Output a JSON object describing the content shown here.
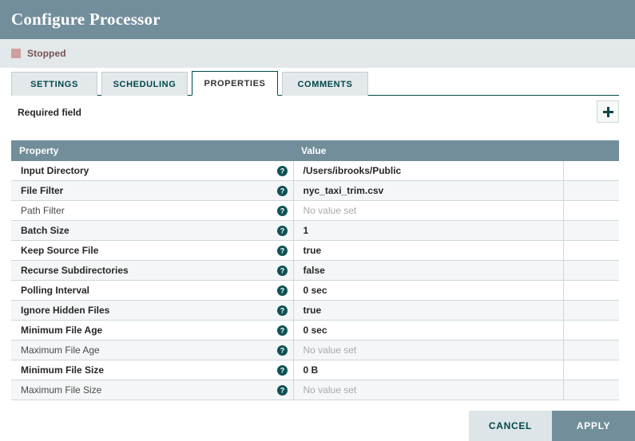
{
  "header": {
    "title": "Configure Processor"
  },
  "status": {
    "label": "Stopped",
    "indicator_color": "#cf9f9c"
  },
  "tabs": [
    {
      "label": "SETTINGS",
      "active": false
    },
    {
      "label": "SCHEDULING",
      "active": false
    },
    {
      "label": "PROPERTIES",
      "active": true
    },
    {
      "label": "COMMENTS",
      "active": false
    }
  ],
  "toolbar": {
    "required_field_label": "Required field",
    "add_button_icon": "plus-icon"
  },
  "table": {
    "columns": [
      "Property",
      "Value"
    ],
    "help_icon": "help-circle-icon",
    "unset_placeholder": "No value set",
    "rows": [
      {
        "name": "Input Directory",
        "required": true,
        "value": "/Users/ibrooks/Public",
        "unset": false
      },
      {
        "name": "File Filter",
        "required": true,
        "value": "nyc_taxi_trim.csv",
        "unset": false
      },
      {
        "name": "Path Filter",
        "required": false,
        "value": "No value set",
        "unset": true
      },
      {
        "name": "Batch Size",
        "required": true,
        "value": "1",
        "unset": false
      },
      {
        "name": "Keep Source File",
        "required": true,
        "value": "true",
        "unset": false
      },
      {
        "name": "Recurse Subdirectories",
        "required": true,
        "value": "false",
        "unset": false
      },
      {
        "name": "Polling Interval",
        "required": true,
        "value": "0 sec",
        "unset": false
      },
      {
        "name": "Ignore Hidden Files",
        "required": true,
        "value": "true",
        "unset": false
      },
      {
        "name": "Minimum File Age",
        "required": true,
        "value": "0 sec",
        "unset": false
      },
      {
        "name": "Maximum File Age",
        "required": false,
        "value": "No value set",
        "unset": true
      },
      {
        "name": "Minimum File Size",
        "required": true,
        "value": "0 B",
        "unset": false
      },
      {
        "name": "Maximum File Size",
        "required": false,
        "value": "No value set",
        "unset": true
      }
    ]
  },
  "footer": {
    "cancel_label": "CANCEL",
    "apply_label": "APPLY"
  },
  "colors": {
    "header_bar": "#728e9b",
    "status_bar": "#e3e8eb",
    "accent_teal": "#004849",
    "table_header": "#728e9b",
    "row_alt": "#f4f6f7",
    "border": "#cdd8dc"
  }
}
